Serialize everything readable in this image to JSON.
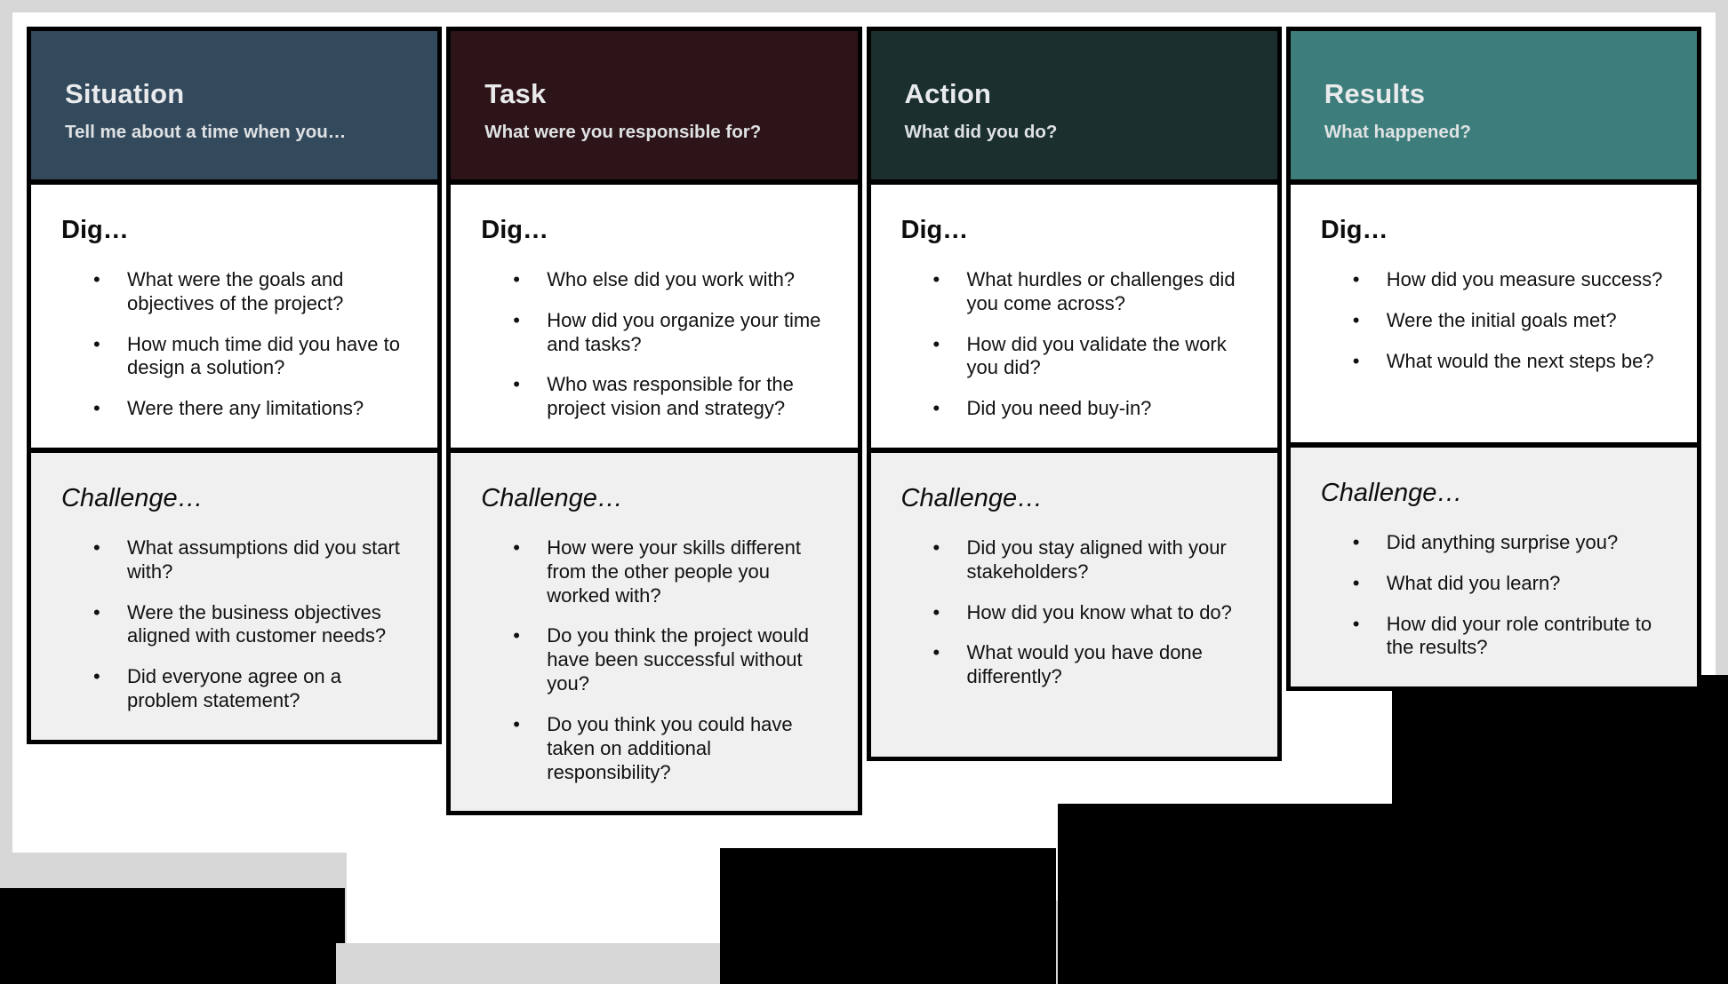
{
  "meta": {
    "framework": "STAR interview framework board",
    "accent_colors": {
      "situation": "#33495c",
      "task": "#2d1418",
      "action": "#1b2f2e",
      "results": "#3d7d7b",
      "page_background": "#d7d7d7",
      "card_border": "#000000",
      "dig_background": "#ffffff",
      "challenge_background": "#f0f0f0"
    }
  },
  "columns": [
    {
      "key": "situation",
      "title": "Situation",
      "subtitle": "Tell me about a time when you…",
      "header_bg": "#33495c",
      "dig": {
        "label": "Dig…",
        "items": [
          "What were the goals and objectives of the project?",
          "How much time did you have to design a solution?",
          "Were there any limitations?"
        ]
      },
      "challenge": {
        "label": "Challenge…",
        "items": [
          "What assumptions did you start with?",
          "Were the business objectives aligned with customer needs?",
          "Did everyone agree on a problem statement?"
        ]
      }
    },
    {
      "key": "task",
      "title": "Task",
      "subtitle": "What were you responsible for?",
      "header_bg": "#2d1418",
      "dig": {
        "label": "Dig…",
        "items": [
          "Who else did you work with?",
          "How did you organize your time and tasks?",
          "Who was responsible for the project vision and strategy?"
        ]
      },
      "challenge": {
        "label": "Challenge…",
        "items": [
          "How were your skills different from the other people you worked with?",
          "Do you think the project would have been successful without you?",
          "Do you think you could have taken on additional responsibility?"
        ]
      }
    },
    {
      "key": "action",
      "title": "Action",
      "subtitle": "What did you do?",
      "header_bg": "#1b2f2e",
      "dig": {
        "label": "Dig…",
        "items": [
          "What hurdles or challenges did you come across?",
          "How did you validate the work you did?",
          "Did you need buy-in?"
        ]
      },
      "challenge": {
        "label": "Challenge…",
        "items": [
          "Did you stay aligned with your stakeholders?",
          "How did you know what to do?",
          "What would you have done differently?"
        ]
      }
    },
    {
      "key": "results",
      "title": "Results",
      "subtitle": "What happened?",
      "header_bg": "#3d7d7b",
      "dig": {
        "label": "Dig…",
        "items": [
          "How did you measure success?",
          "Were the initial goals met?",
          "What would the next steps be?"
        ]
      },
      "challenge": {
        "label": "Challenge…",
        "items": [
          "Did anything surprise you?",
          "What did you learn?",
          "How did your role contribute to the results?"
        ]
      }
    }
  ],
  "bullet_glyph": "•"
}
